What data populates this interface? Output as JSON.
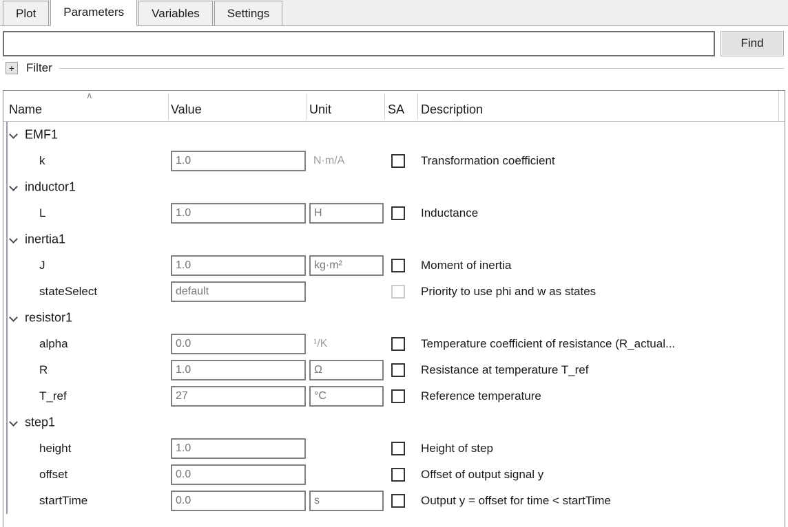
{
  "tabs": [
    {
      "label": "Plot",
      "active": false
    },
    {
      "label": "Parameters",
      "active": true
    },
    {
      "label": "Variables",
      "active": false
    },
    {
      "label": "Settings",
      "active": false
    }
  ],
  "search": {
    "value": "",
    "placeholder": "",
    "find_label": "Find"
  },
  "filter": {
    "expander_label": "+",
    "label": "Filter"
  },
  "table": {
    "columns": [
      {
        "key": "name",
        "label": "Name",
        "sorted": true,
        "sort_indicator": "∧"
      },
      {
        "key": "value",
        "label": "Value"
      },
      {
        "key": "unit",
        "label": "Unit"
      },
      {
        "key": "sa",
        "label": "SA"
      },
      {
        "key": "description",
        "label": "Description"
      }
    ],
    "rows": [
      {
        "type": "group",
        "name": "EMF1",
        "expanded": true
      },
      {
        "type": "param",
        "name": "k",
        "value": "1.0",
        "unit": "N·m/A",
        "unit_boxed": false,
        "sa_checked": false,
        "sa_enabled": true,
        "description": "Transformation coefficient"
      },
      {
        "type": "group",
        "name": "inductor1",
        "expanded": true
      },
      {
        "type": "param",
        "name": "L",
        "value": "1.0",
        "unit": "H",
        "unit_boxed": true,
        "sa_checked": false,
        "sa_enabled": true,
        "description": "Inductance"
      },
      {
        "type": "group",
        "name": "inertia1",
        "expanded": true
      },
      {
        "type": "param",
        "name": "J",
        "value": "1.0",
        "unit": "kg·m²",
        "unit_boxed": true,
        "sa_checked": false,
        "sa_enabled": true,
        "description": "Moment of inertia"
      },
      {
        "type": "param",
        "name": "stateSelect",
        "value": "default",
        "unit": "",
        "unit_boxed": false,
        "sa_checked": false,
        "sa_enabled": false,
        "description": "Priority to use phi and w as states"
      },
      {
        "type": "group",
        "name": "resistor1",
        "expanded": true
      },
      {
        "type": "param",
        "name": "alpha",
        "value": "0.0",
        "unit": "¹/K",
        "unit_boxed": false,
        "sa_checked": false,
        "sa_enabled": true,
        "description": "Temperature coefficient of resistance (R_actual..."
      },
      {
        "type": "param",
        "name": "R",
        "value": "1.0",
        "unit": "Ω",
        "unit_boxed": true,
        "sa_checked": false,
        "sa_enabled": true,
        "description": "Resistance at temperature T_ref"
      },
      {
        "type": "param",
        "name": "T_ref",
        "value": "27",
        "unit": "°C",
        "unit_boxed": true,
        "sa_checked": false,
        "sa_enabled": true,
        "description": "Reference temperature"
      },
      {
        "type": "group",
        "name": "step1",
        "expanded": true
      },
      {
        "type": "param",
        "name": "height",
        "value": "1.0",
        "unit": "",
        "unit_boxed": false,
        "sa_checked": false,
        "sa_enabled": true,
        "description": "Height of step"
      },
      {
        "type": "param",
        "name": "offset",
        "value": "0.0",
        "unit": "",
        "unit_boxed": false,
        "sa_checked": false,
        "sa_enabled": true,
        "description": "Offset of output signal y"
      },
      {
        "type": "param",
        "name": "startTime",
        "value": "0.0",
        "unit": "s",
        "unit_boxed": true,
        "sa_checked": false,
        "sa_enabled": true,
        "description": "Output y = offset for time < startTime"
      }
    ]
  }
}
